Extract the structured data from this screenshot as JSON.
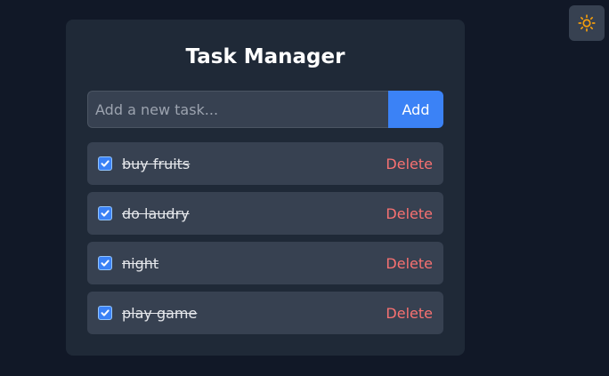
{
  "theme_toggle": {
    "icon": "sun-icon",
    "icon_color": "#f59e0b"
  },
  "app": {
    "title": "Task Manager"
  },
  "new_task": {
    "placeholder": "Add a new task...",
    "value": "",
    "add_label": "Add"
  },
  "colors": {
    "page_bg": "#111827",
    "card_bg": "#1f2937",
    "item_bg": "#374151",
    "accent": "#3b82f6",
    "delete": "#f87171"
  },
  "tasks": [
    {
      "text": "buy fruits",
      "done": true,
      "delete_label": "Delete"
    },
    {
      "text": "do laudry",
      "done": true,
      "delete_label": "Delete"
    },
    {
      "text": "night",
      "done": true,
      "delete_label": "Delete"
    },
    {
      "text": "play game",
      "done": true,
      "delete_label": "Delete"
    }
  ]
}
